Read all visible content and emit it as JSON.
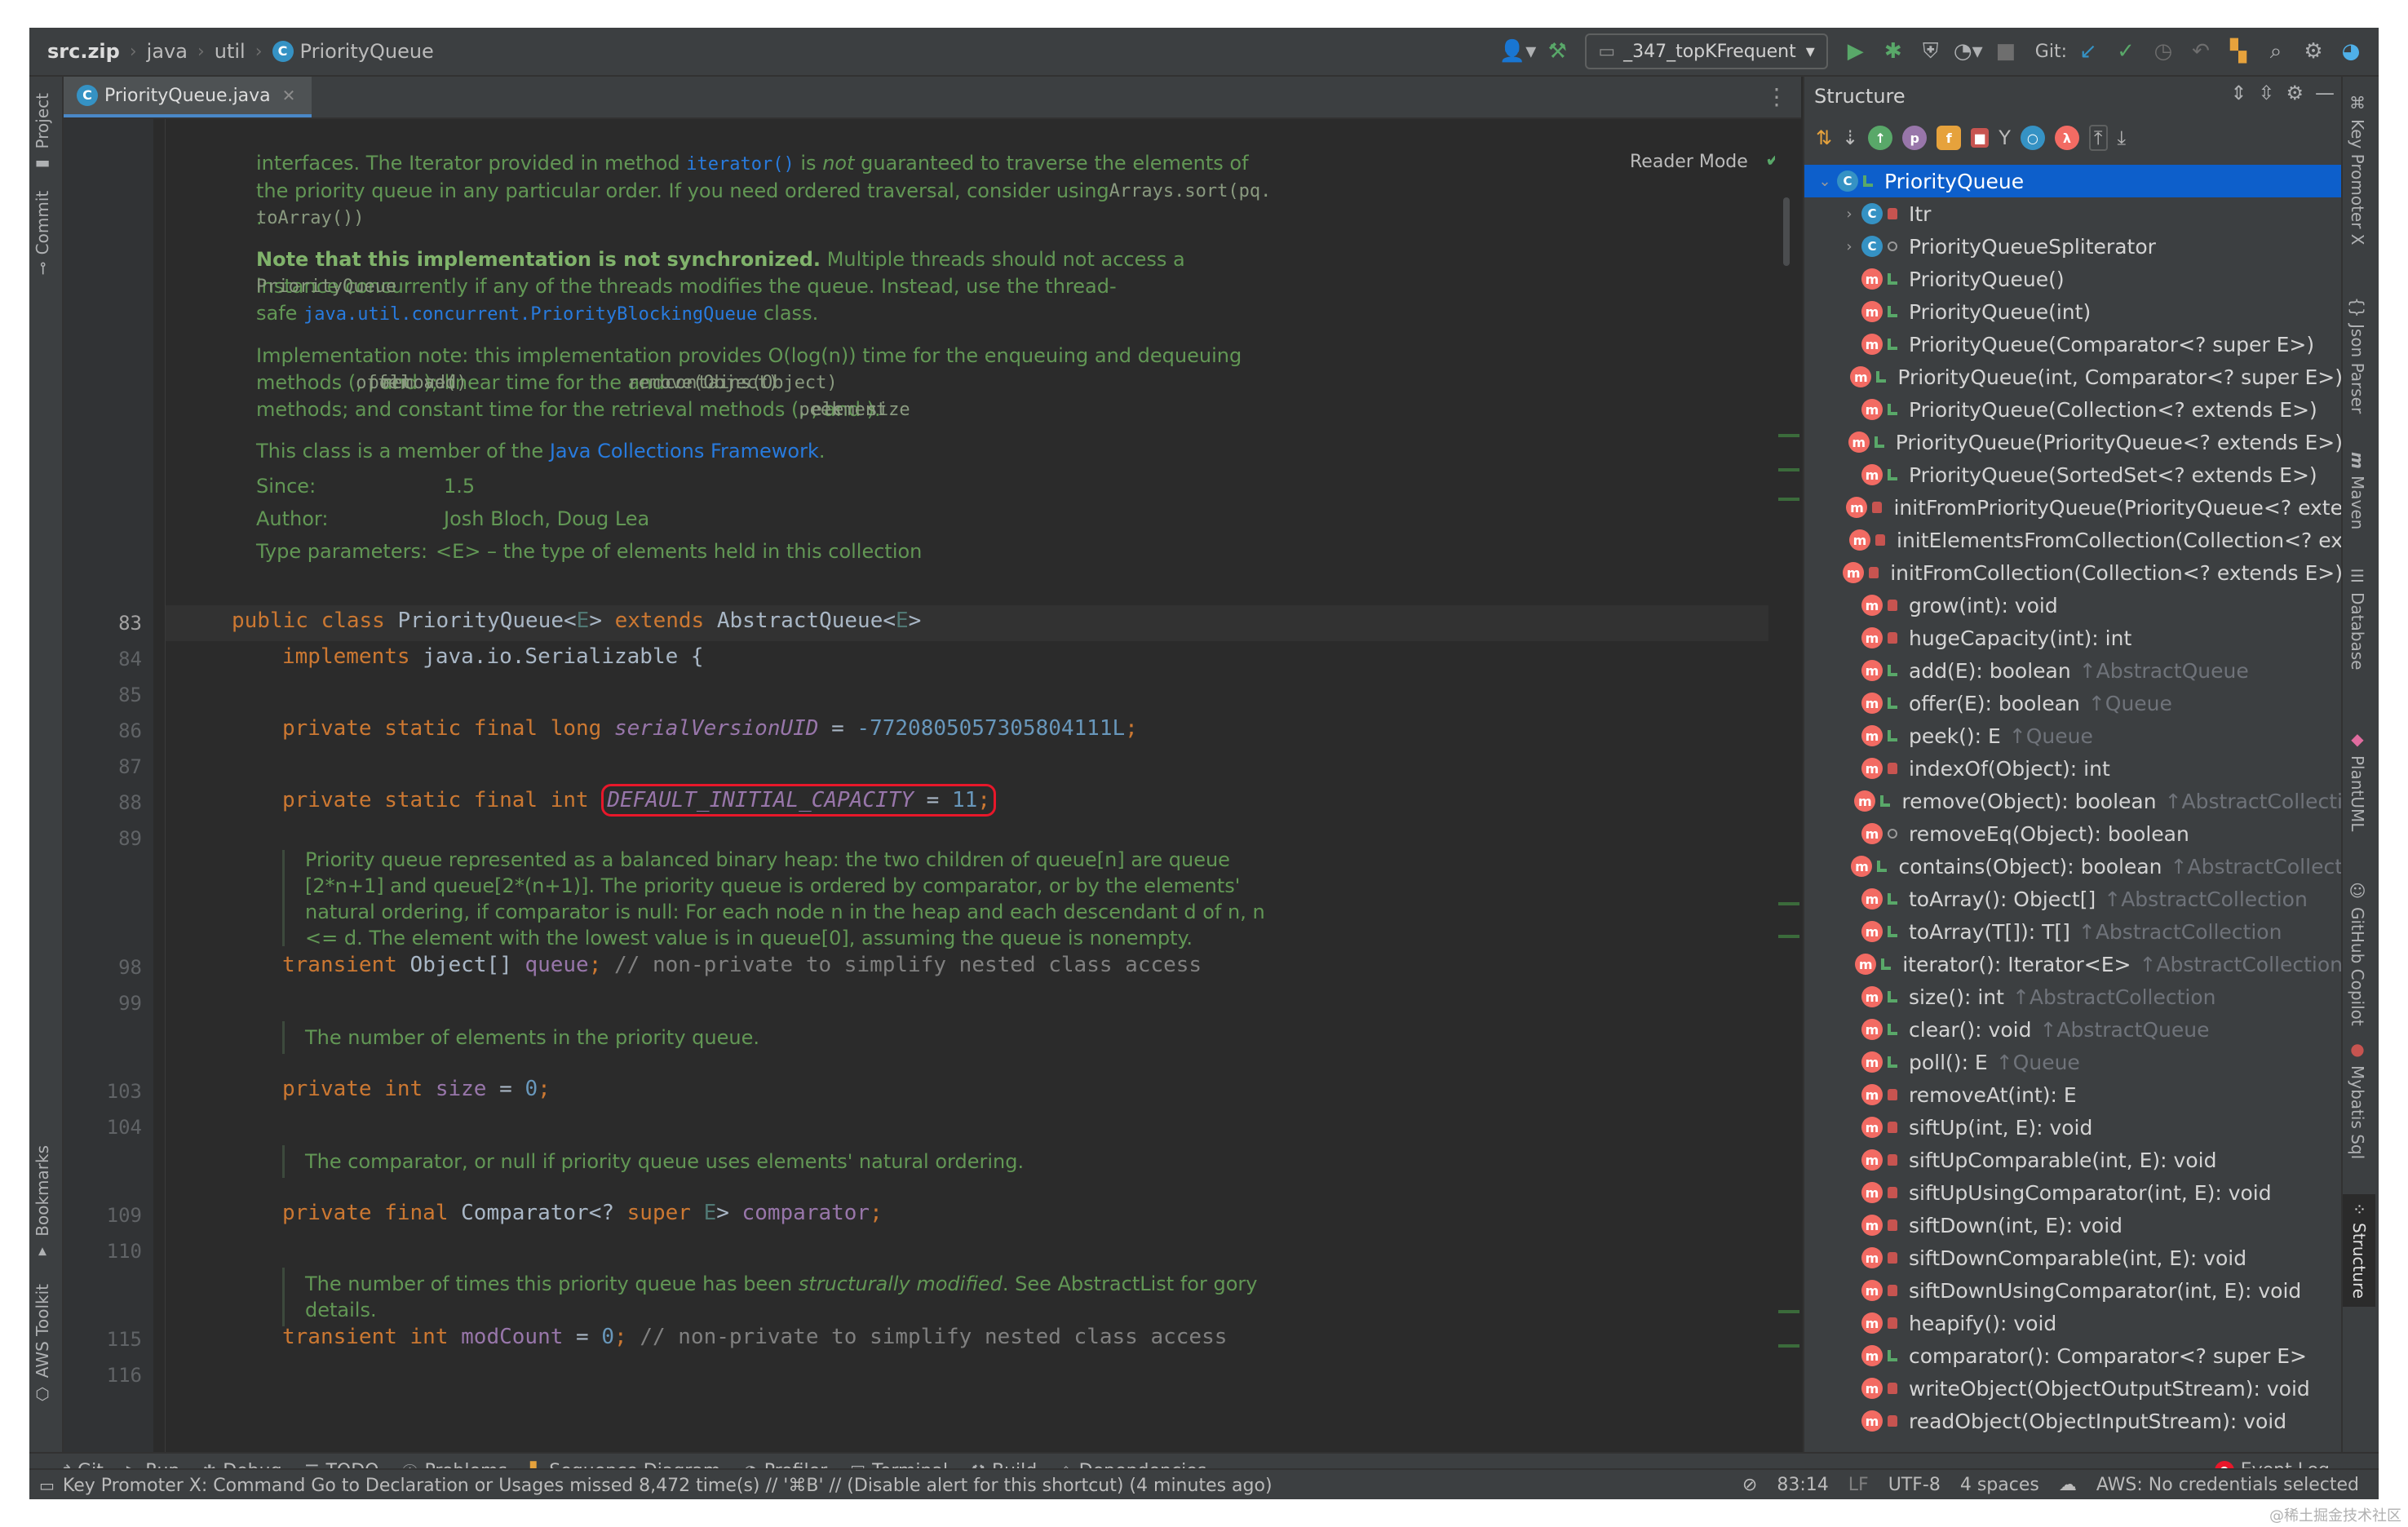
{
  "breadcrumb": {
    "items": [
      "src.zip",
      "java",
      "util",
      "PriorityQueue"
    ]
  },
  "toolbar": {
    "run_config": "_347_topKFrequent",
    "git_label": "Git:"
  },
  "editor": {
    "tab_label": "PriorityQueue.java",
    "reader_mode": "Reader Mode",
    "doc1": {
      "line1a": "interfaces. The Iterator provided in method ",
      "line1b": "iterator()",
      "line1c": " is ",
      "line1d": "not",
      "line1e": " guaranteed to traverse the elements of",
      "line2a": "the priority queue in any particular order. If you need ordered traversal, consider using ",
      "line2b": "Arrays.sort(pq.",
      "line3": "toArray())",
      "line3b": "."
    },
    "doc2": {
      "bold": "Note that this implementation is not synchronized.",
      "a": " Multiple threads should not access a",
      "b": "PriorityQueue",
      "c": " instance concurrently if any of the threads modifies the queue. Instead, use the thread-",
      "d": "safe ",
      "e": "java.util.concurrent.PriorityBlockingQueue",
      "f": " class."
    },
    "doc3": {
      "a": "Implementation note: this implementation provides O(log(n)) time for the enqueuing and dequeuing",
      "b": "methods (",
      "c": "offer",
      "d": ", ",
      "e": "poll",
      "f": ", ",
      "g": "remove()",
      "h": " and ",
      "i": "add",
      "j": "); linear time for the ",
      "k": "remove(Object)",
      "l": " and ",
      "m": "contains(Object)",
      "n": "methods; and constant time for the retrieval methods (",
      "o": "peek",
      "p": ", ",
      "q": "element",
      "r": ", and ",
      "s": "size",
      "t": ")."
    },
    "doc4": {
      "a": "This class is a member of the ",
      "b": "Java Collections Framework",
      "c": "."
    },
    "doc_meta": [
      {
        "k": "Since:",
        "v": "1.5"
      },
      {
        "k": "Author:",
        "v": "Josh Bloch, Doug Lea"
      },
      {
        "k": "Type parameters:",
        "v": "<E> – the type of elements held in this collection"
      }
    ],
    "line_numbers": [
      "83",
      "84",
      "85",
      "86",
      "87",
      "88",
      "89",
      "98",
      "99",
      "103",
      "104",
      "109",
      "110",
      "115",
      "116"
    ],
    "code": {
      "l83": {
        "kw1": "public class ",
        "name": "PriorityQueue",
        "lt": "<",
        "tp": "E",
        "gt": "> ",
        "kw2": "extends ",
        "base": "AbstractQueue",
        "lt2": "<",
        "tp2": "E",
        "gt2": ">"
      },
      "l84": {
        "kw": "implements ",
        "rest": "java.io.Serializable {"
      },
      "l86": {
        "kw": "private static final long ",
        "field": "serialVersionUID",
        "eq": " = ",
        "num": "-7720805057305804111L",
        "semi": ";"
      },
      "l88": {
        "kw": "private static final int ",
        "field": "DEFAULT_INITIAL_CAPACITY",
        "eq": " = ",
        "num": "11",
        "semi": ";"
      },
      "l98": {
        "kw": "transient ",
        "type": "Object[] ",
        "field": "queue",
        "semi": "; ",
        "cmt": "// non-private to simplify nested class access"
      },
      "l103": {
        "kw": "private int ",
        "field": "size",
        "eq": " = ",
        "num": "0",
        "semi": ";"
      },
      "l109": {
        "kw": "private final ",
        "type": "Comparator<? ",
        "kw2": "super ",
        "tp": "E",
        "gt": "> ",
        "field": "comparator",
        "semi": ";"
      },
      "l115": {
        "kw": "transient int ",
        "field": "modCount",
        "eq": " = ",
        "num": "0",
        "semi": "; ",
        "cmt": "// non-private to simplify nested class access"
      }
    },
    "doc_queue": [
      "Priority queue represented as a balanced binary heap: the two children of queue[n] are queue",
      "[2*n+1] and queue[2*(n+1)]. The priority queue is ordered by comparator, or by the elements'",
      "natural ordering, if comparator is null: For each node n in the heap and each descendant d of n, n",
      "<= d. The element with the lowest value is in queue[0], assuming the queue is nonempty."
    ],
    "doc_size": "The number of elements in the priority queue.",
    "doc_comparator": "The comparator, or null if priority queue uses elements' natural ordering.",
    "doc_modcount": {
      "a": "The number of times this priority queue has been ",
      "b": "structurally modified",
      "c": ". See AbstractList for gory",
      "d": "details."
    }
  },
  "structure": {
    "title": "Structure",
    "items": [
      {
        "label": "PriorityQueue",
        "kind": "class",
        "vis": "pub",
        "selected": true,
        "expand": "open",
        "inherited": ""
      },
      {
        "label": "Itr",
        "kind": "class",
        "vis": "priv",
        "expand": "closed",
        "inherited": ""
      },
      {
        "label": "PriorityQueueSpliterator",
        "kind": "class",
        "vis": "pkg",
        "expand": "closed",
        "inherited": ""
      },
      {
        "label": "PriorityQueue()",
        "kind": "method",
        "vis": "pub",
        "inherited": ""
      },
      {
        "label": "PriorityQueue(int)",
        "kind": "method",
        "vis": "pub",
        "inherited": ""
      },
      {
        "label": "PriorityQueue(Comparator<? super E>)",
        "kind": "method",
        "vis": "pub",
        "inherited": ""
      },
      {
        "label": "PriorityQueue(int, Comparator<? super E>)",
        "kind": "method",
        "vis": "pub",
        "inherited": ""
      },
      {
        "label": "PriorityQueue(Collection<? extends E>)",
        "kind": "method",
        "vis": "pub",
        "inherited": ""
      },
      {
        "label": "PriorityQueue(PriorityQueue<? extends E>)",
        "kind": "method",
        "vis": "pub",
        "inherited": ""
      },
      {
        "label": "PriorityQueue(SortedSet<? extends E>)",
        "kind": "method",
        "vis": "pub",
        "inherited": ""
      },
      {
        "label": "initFromPriorityQueue(PriorityQueue<? exte",
        "kind": "method",
        "vis": "priv",
        "inherited": ""
      },
      {
        "label": "initElementsFromCollection(Collection<? ex",
        "kind": "method",
        "vis": "priv",
        "inherited": ""
      },
      {
        "label": "initFromCollection(Collection<? extends E>)",
        "kind": "method",
        "vis": "priv",
        "inherited": ""
      },
      {
        "label": "grow(int): void",
        "kind": "method",
        "vis": "priv",
        "inherited": ""
      },
      {
        "label": "hugeCapacity(int): int",
        "kind": "method",
        "vis": "priv",
        "inherited": ""
      },
      {
        "label": "add(E): boolean",
        "kind": "method",
        "vis": "pub",
        "inherited": "↑AbstractQueue"
      },
      {
        "label": "offer(E): boolean",
        "kind": "method",
        "vis": "pub",
        "inherited": "↑Queue"
      },
      {
        "label": "peek(): E",
        "kind": "method",
        "vis": "pub",
        "inherited": "↑Queue"
      },
      {
        "label": "indexOf(Object): int",
        "kind": "method",
        "vis": "priv",
        "inherited": ""
      },
      {
        "label": "remove(Object): boolean",
        "kind": "method",
        "vis": "pub",
        "inherited": "↑AbstractCollecti"
      },
      {
        "label": "removeEq(Object): boolean",
        "kind": "method",
        "vis": "pkg",
        "inherited": ""
      },
      {
        "label": "contains(Object): boolean",
        "kind": "method",
        "vis": "pub",
        "inherited": "↑AbstractCollect"
      },
      {
        "label": "toArray(): Object[]",
        "kind": "method",
        "vis": "pub",
        "inherited": "↑AbstractCollection"
      },
      {
        "label": "toArray(T[]): T[]",
        "kind": "method",
        "vis": "pub",
        "inherited": "↑AbstractCollection"
      },
      {
        "label": "iterator(): Iterator<E>",
        "kind": "method",
        "vis": "pub",
        "inherited": "↑AbstractCollection"
      },
      {
        "label": "size(): int",
        "kind": "method",
        "vis": "pub",
        "inherited": "↑AbstractCollection"
      },
      {
        "label": "clear(): void",
        "kind": "method",
        "vis": "pub",
        "inherited": "↑AbstractQueue"
      },
      {
        "label": "poll(): E",
        "kind": "method",
        "vis": "pub",
        "inherited": "↑Queue"
      },
      {
        "label": "removeAt(int): E",
        "kind": "method",
        "vis": "priv",
        "inherited": ""
      },
      {
        "label": "siftUp(int, E): void",
        "kind": "method",
        "vis": "priv",
        "inherited": ""
      },
      {
        "label": "siftUpComparable(int, E): void",
        "kind": "method",
        "vis": "priv",
        "inherited": ""
      },
      {
        "label": "siftUpUsingComparator(int, E): void",
        "kind": "method",
        "vis": "priv",
        "inherited": ""
      },
      {
        "label": "siftDown(int, E): void",
        "kind": "method",
        "vis": "priv",
        "inherited": ""
      },
      {
        "label": "siftDownComparable(int, E): void",
        "kind": "method",
        "vis": "priv",
        "inherited": ""
      },
      {
        "label": "siftDownUsingComparator(int, E): void",
        "kind": "method",
        "vis": "priv",
        "inherited": ""
      },
      {
        "label": "heapify(): void",
        "kind": "method",
        "vis": "priv",
        "inherited": ""
      },
      {
        "label": "comparator(): Comparator<? super E>",
        "kind": "method",
        "vis": "pub",
        "inherited": ""
      },
      {
        "label": "writeObject(ObjectOutputStream): void",
        "kind": "method",
        "vis": "priv",
        "inherited": ""
      },
      {
        "label": "readObject(ObjectInputStream): void",
        "kind": "method",
        "vis": "priv",
        "inherited": ""
      }
    ]
  },
  "left_tabs": [
    "Project",
    "Commit",
    "Bookmarks",
    "AWS Toolkit"
  ],
  "right_tabs": [
    "Key Promoter X",
    "Json Parser",
    "Maven",
    "Database",
    "PlantUML",
    "GitHub Copilot",
    "Mybatis Sql",
    "Structure"
  ],
  "bottom_tools": [
    "Git",
    "Run",
    "Debug",
    "TODO",
    "Problems",
    "Sequence Diagram",
    "Profiler",
    "Terminal",
    "Build",
    "Dependencies"
  ],
  "event_log": "Event Log",
  "status": {
    "message": "Key Promoter X: Command Go to Declaration or Usages missed 8,472 time(s) // '⌘B' // (Disable alert for this shortcut) (4 minutes ago)",
    "position": "83:14",
    "line_sep": "LF",
    "encoding": "UTF-8",
    "indent": "4 spaces",
    "aws": "AWS: No credentials selected"
  },
  "watermark": "@稀土掘金技术社区"
}
